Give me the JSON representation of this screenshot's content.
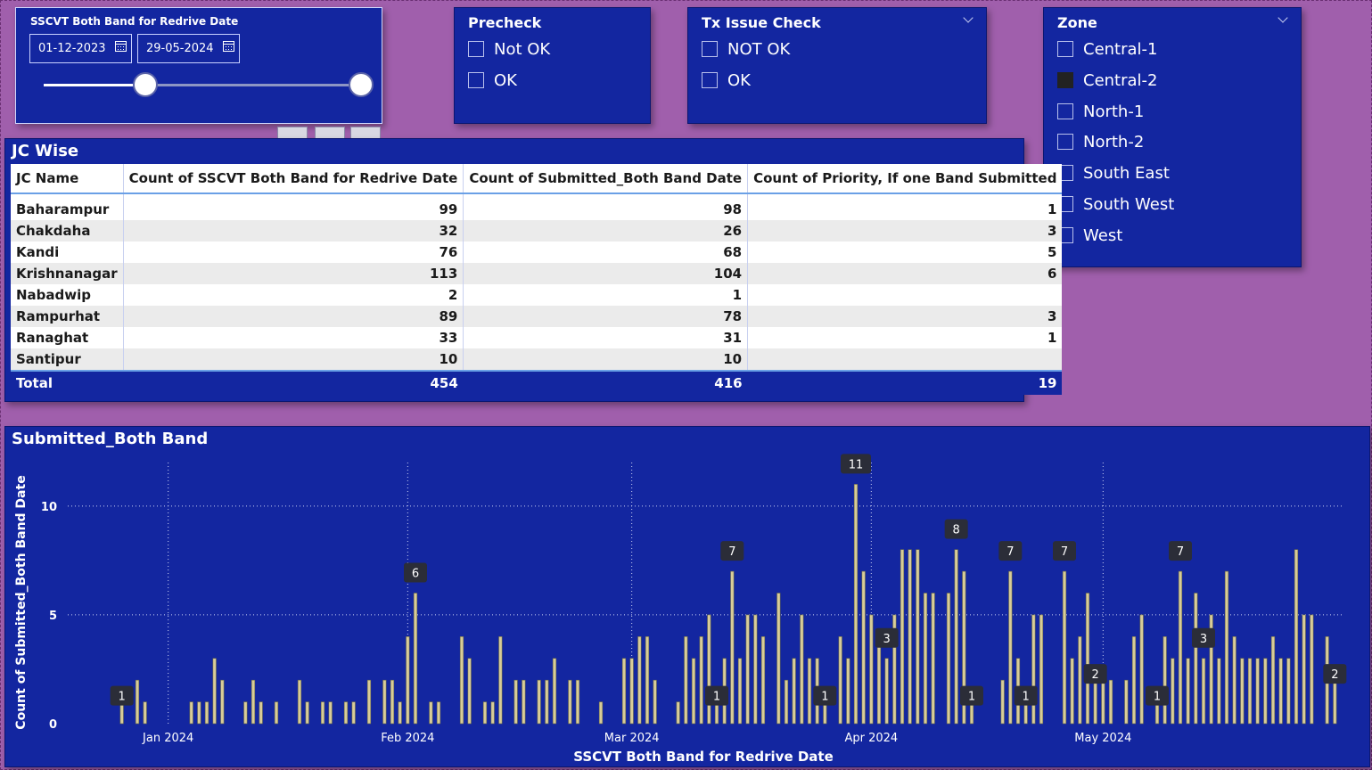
{
  "date_filter": {
    "title": "SSCVT Both Band for Redrive Date",
    "start_date": "01-12-2023",
    "end_date": "29-05-2024",
    "range_fraction": [
      0.32,
      1.0
    ]
  },
  "precheck": {
    "title": "Precheck",
    "options": [
      {
        "label": "Not OK",
        "checked": false
      },
      {
        "label": "OK",
        "checked": false
      }
    ]
  },
  "tx_issue": {
    "title": "Tx Issue Check",
    "options": [
      {
        "label": "NOT OK",
        "checked": false
      },
      {
        "label": "OK",
        "checked": false
      }
    ]
  },
  "zone": {
    "title": "Zone",
    "options": [
      {
        "label": "Central-1",
        "checked": false
      },
      {
        "label": "Central-2",
        "checked": true
      },
      {
        "label": "North-1",
        "checked": false
      },
      {
        "label": "North-2",
        "checked": false
      },
      {
        "label": "South East",
        "checked": false
      },
      {
        "label": "South West",
        "checked": false
      },
      {
        "label": "West",
        "checked": false
      }
    ]
  },
  "jc_table": {
    "title": "JC Wise",
    "columns": [
      "JC Name",
      "Count of SSCVT Both Band for Redrive Date",
      "Count of Submitted_Both Band Date",
      "Count of Priority, If one Band Submitted"
    ],
    "rows": [
      [
        "Baharampur",
        "99",
        "98",
        "1"
      ],
      [
        "Chakdaha",
        "32",
        "26",
        "3"
      ],
      [
        "Kandi",
        "76",
        "68",
        "5"
      ],
      [
        "Krishnanagar",
        "113",
        "104",
        "6"
      ],
      [
        "Nabadwip",
        "2",
        "1",
        ""
      ],
      [
        "Rampurhat",
        "89",
        "78",
        "3"
      ],
      [
        "Ranaghat",
        "33",
        "31",
        "1"
      ],
      [
        "Santipur",
        "10",
        "10",
        ""
      ]
    ],
    "total": [
      "Total",
      "454",
      "416",
      "19"
    ]
  },
  "colors": {
    "page_bg": "#a05fac",
    "card_bg": "#1326a0",
    "bar": "#d8cc98",
    "label_bg": "#2b2d38"
  },
  "chart_data": {
    "type": "bar",
    "title": "Submitted_Both Band",
    "xlabel": "SSCVT Both Band for Redrive Date",
    "ylabel": "Count of Submitted_Both Band Date",
    "ylim": [
      0,
      12
    ],
    "yticks": [
      0,
      5,
      10
    ],
    "xlim": [
      "2023-12-20",
      "2024-05-31"
    ],
    "xticks": [
      {
        "date": "2024-01-01",
        "label": "Jan 2024"
      },
      {
        "date": "2024-02-01",
        "label": "Feb 2024"
      },
      {
        "date": "2024-03-01",
        "label": "Mar 2024"
      },
      {
        "date": "2024-04-01",
        "label": "Apr 2024"
      },
      {
        "date": "2024-05-01",
        "label": "May 2024"
      }
    ],
    "grid": true,
    "points": [
      [
        "2023-12-26",
        1,
        true
      ],
      [
        "2023-12-28",
        2,
        false
      ],
      [
        "2023-12-29",
        1,
        false
      ],
      [
        "2024-01-04",
        1,
        false
      ],
      [
        "2024-01-05",
        1,
        false
      ],
      [
        "2024-01-06",
        1,
        false
      ],
      [
        "2024-01-07",
        3,
        false
      ],
      [
        "2024-01-08",
        2,
        false
      ],
      [
        "2024-01-11",
        1,
        false
      ],
      [
        "2024-01-12",
        2,
        false
      ],
      [
        "2024-01-13",
        1,
        false
      ],
      [
        "2024-01-15",
        1,
        false
      ],
      [
        "2024-01-18",
        2,
        false
      ],
      [
        "2024-01-19",
        1,
        false
      ],
      [
        "2024-01-21",
        1,
        false
      ],
      [
        "2024-01-22",
        1,
        false
      ],
      [
        "2024-01-24",
        1,
        false
      ],
      [
        "2024-01-25",
        1,
        false
      ],
      [
        "2024-01-27",
        2,
        false
      ],
      [
        "2024-01-29",
        2,
        false
      ],
      [
        "2024-01-30",
        2,
        false
      ],
      [
        "2024-01-31",
        1,
        false
      ],
      [
        "2024-02-01",
        4,
        false
      ],
      [
        "2024-02-02",
        6,
        true
      ],
      [
        "2024-02-04",
        1,
        false
      ],
      [
        "2024-02-05",
        1,
        false
      ],
      [
        "2024-02-08",
        4,
        false
      ],
      [
        "2024-02-09",
        3,
        false
      ],
      [
        "2024-02-11",
        1,
        false
      ],
      [
        "2024-02-12",
        1,
        false
      ],
      [
        "2024-02-13",
        4,
        false
      ],
      [
        "2024-02-15",
        2,
        false
      ],
      [
        "2024-02-16",
        2,
        false
      ],
      [
        "2024-02-18",
        2,
        false
      ],
      [
        "2024-02-19",
        2,
        false
      ],
      [
        "2024-02-20",
        3,
        false
      ],
      [
        "2024-02-22",
        2,
        false
      ],
      [
        "2024-02-23",
        2,
        false
      ],
      [
        "2024-02-26",
        1,
        false
      ],
      [
        "2024-02-29",
        3,
        false
      ],
      [
        "2024-03-01",
        3,
        false
      ],
      [
        "2024-03-02",
        4,
        false
      ],
      [
        "2024-03-03",
        4,
        false
      ],
      [
        "2024-03-04",
        2,
        false
      ],
      [
        "2024-03-07",
        1,
        false
      ],
      [
        "2024-03-08",
        4,
        false
      ],
      [
        "2024-03-09",
        3,
        false
      ],
      [
        "2024-03-10",
        4,
        false
      ],
      [
        "2024-03-11",
        5,
        false
      ],
      [
        "2024-03-12",
        1,
        true
      ],
      [
        "2024-03-13",
        3,
        false
      ],
      [
        "2024-03-14",
        7,
        true
      ],
      [
        "2024-03-15",
        3,
        false
      ],
      [
        "2024-03-16",
        5,
        false
      ],
      [
        "2024-03-17",
        5,
        false
      ],
      [
        "2024-03-18",
        4,
        false
      ],
      [
        "2024-03-20",
        6,
        false
      ],
      [
        "2024-03-21",
        2,
        false
      ],
      [
        "2024-03-22",
        3,
        false
      ],
      [
        "2024-03-23",
        5,
        false
      ],
      [
        "2024-03-24",
        3,
        false
      ],
      [
        "2024-03-25",
        3,
        false
      ],
      [
        "2024-03-26",
        1,
        true
      ],
      [
        "2024-03-28",
        4,
        false
      ],
      [
        "2024-03-29",
        3,
        false
      ],
      [
        "2024-03-30",
        11,
        true
      ],
      [
        "2024-03-31",
        7,
        false
      ],
      [
        "2024-04-01",
        5,
        false
      ],
      [
        "2024-04-02",
        4,
        false
      ],
      [
        "2024-04-03",
        3,
        true
      ],
      [
        "2024-04-04",
        5,
        false
      ],
      [
        "2024-04-05",
        8,
        false
      ],
      [
        "2024-04-06",
        8,
        false
      ],
      [
        "2024-04-07",
        8,
        false
      ],
      [
        "2024-04-08",
        6,
        false
      ],
      [
        "2024-04-09",
        6,
        false
      ],
      [
        "2024-04-11",
        6,
        false
      ],
      [
        "2024-04-12",
        8,
        true
      ],
      [
        "2024-04-13",
        7,
        false
      ],
      [
        "2024-04-14",
        1,
        true
      ],
      [
        "2024-04-18",
        2,
        false
      ],
      [
        "2024-04-19",
        7,
        true
      ],
      [
        "2024-04-20",
        3,
        false
      ],
      [
        "2024-04-21",
        1,
        true
      ],
      [
        "2024-04-22",
        5,
        false
      ],
      [
        "2024-04-23",
        5,
        false
      ],
      [
        "2024-04-26",
        7,
        true
      ],
      [
        "2024-04-27",
        3,
        false
      ],
      [
        "2024-04-28",
        4,
        false
      ],
      [
        "2024-04-29",
        6,
        false
      ],
      [
        "2024-04-30",
        2,
        true
      ],
      [
        "2024-05-01",
        2,
        false
      ],
      [
        "2024-05-02",
        2,
        false
      ],
      [
        "2024-05-04",
        2,
        false
      ],
      [
        "2024-05-05",
        4,
        false
      ],
      [
        "2024-05-06",
        5,
        false
      ],
      [
        "2024-05-08",
        1,
        true
      ],
      [
        "2024-05-09",
        4,
        false
      ],
      [
        "2024-05-10",
        3,
        false
      ],
      [
        "2024-05-11",
        7,
        true
      ],
      [
        "2024-05-12",
        3,
        false
      ],
      [
        "2024-05-13",
        6,
        false
      ],
      [
        "2024-05-14",
        3,
        true
      ],
      [
        "2024-05-15",
        5,
        false
      ],
      [
        "2024-05-16",
        3,
        false
      ],
      [
        "2024-05-17",
        7,
        false
      ],
      [
        "2024-05-18",
        4,
        false
      ],
      [
        "2024-05-19",
        3,
        false
      ],
      [
        "2024-05-20",
        3,
        false
      ],
      [
        "2024-05-21",
        3,
        false
      ],
      [
        "2024-05-22",
        3,
        false
      ],
      [
        "2024-05-23",
        4,
        false
      ],
      [
        "2024-05-24",
        3,
        false
      ],
      [
        "2024-05-25",
        3,
        false
      ],
      [
        "2024-05-26",
        8,
        false
      ],
      [
        "2024-05-27",
        5,
        false
      ],
      [
        "2024-05-28",
        5,
        false
      ],
      [
        "2024-05-30",
        4,
        false
      ],
      [
        "2024-05-31",
        2,
        true
      ]
    ]
  }
}
